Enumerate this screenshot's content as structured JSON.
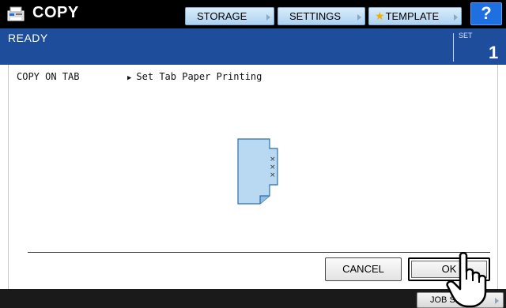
{
  "header": {
    "app_title": "COPY",
    "app_icon": "copier-icon",
    "storage_label": "STORAGE",
    "settings_label": "SETTINGS",
    "template_label": "TEMPLATE",
    "help_label": "?"
  },
  "status": {
    "text": "READY",
    "set_label": "SET",
    "set_count": "1"
  },
  "content": {
    "breadcrumb": "COPY ON TAB",
    "subtitle": "Set Tab Paper Printing",
    "paper_icon": "tab-paper-icon"
  },
  "buttons": {
    "cancel_label": "CANCEL",
    "ok_label": "OK"
  },
  "footer": {
    "job_status_label": "JOB STATUS"
  },
  "colors": {
    "status_bar": "#1e4d9c",
    "paper_fill": "#b9d9f2",
    "help_button": "#1e6fe0"
  }
}
